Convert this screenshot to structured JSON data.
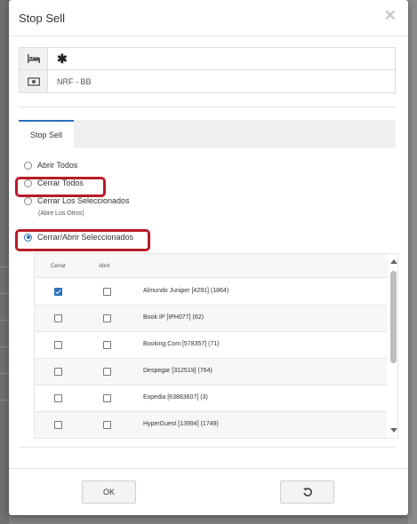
{
  "dialog": {
    "title": "Stop Sell",
    "close_icon": "close-icon"
  },
  "info": {
    "hotel_value": "✱",
    "rate_value": "NRF - BB"
  },
  "tab": {
    "label": "Stop Sell"
  },
  "options": {
    "open_all": "Abrir Todos",
    "close_all": "Cerrar Todos",
    "close_selected": "Cerrar Los Seleccionados",
    "close_selected_note": "(Abre Los Otros)",
    "close_open_selected": "Cerrar/Abrir Seleccionados",
    "selected": "close_open_selected"
  },
  "table": {
    "col_close": "Cerrar",
    "col_open": "Abrir",
    "rows": [
      {
        "name": "Almundo Juniper [4291] (1864)",
        "close": true,
        "open": false
      },
      {
        "name": "Book IP [IPH077] (62)",
        "close": false,
        "open": false
      },
      {
        "name": "Booking.Com [578357] (71)",
        "close": false,
        "open": false
      },
      {
        "name": "Despegar [312519] (764)",
        "close": false,
        "open": false
      },
      {
        "name": "Expedia [63883607] (3)",
        "close": false,
        "open": false
      },
      {
        "name": "HyperGuest [13994] (1749)",
        "close": false,
        "open": false
      }
    ]
  },
  "footer": {
    "ok_label": "OK",
    "reset_icon": "reset-icon"
  },
  "colors": {
    "accent": "#2a6fbd",
    "highlight": "#b81b28"
  }
}
